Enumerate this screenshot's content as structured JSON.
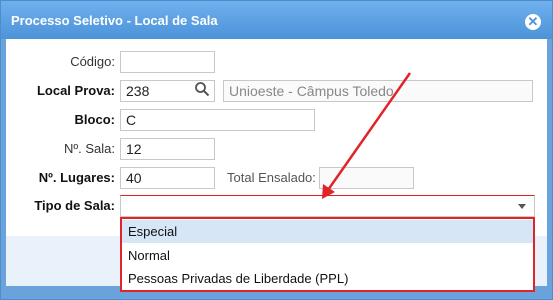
{
  "dialog": {
    "title": "Processo Seletivo - Local de Sala",
    "close_icon": "close-icon"
  },
  "form": {
    "codigo": {
      "label": "Código:",
      "value": ""
    },
    "local_prova": {
      "label": "Local Prova:",
      "code": "238",
      "description": "Unioeste - Câmpus Toledo",
      "search_icon": "search-icon"
    },
    "bloco": {
      "label": "Bloco:",
      "value": "C"
    },
    "numero_sala": {
      "label": "Nº. Sala:",
      "value": "12"
    },
    "numero_lugares": {
      "label": "Nº. Lugares:",
      "value": "40"
    },
    "total_ensalado": {
      "label": "Total Ensalado:",
      "value": ""
    },
    "tipo_sala": {
      "label": "Tipo de Sala:",
      "value": "",
      "options": [
        "Especial",
        "Normal",
        "Pessoas Privadas de Liberdade (PPL)"
      ],
      "highlighted_option": "Especial"
    }
  },
  "colors": {
    "title_bar": "#4d93d9",
    "annotation": "#e0242a",
    "highlight": "#d6e6f7"
  }
}
